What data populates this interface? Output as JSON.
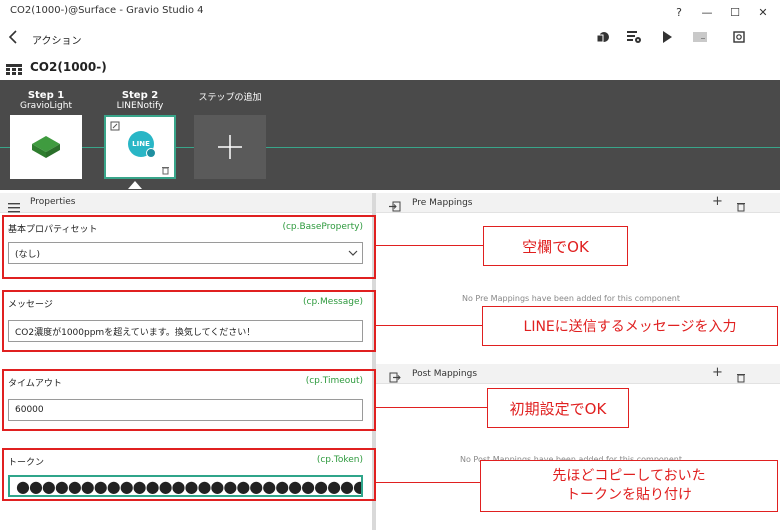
{
  "window": {
    "title": "CO2(1000-)@Surface - Gravio Studio 4",
    "controls": {
      "help": "?",
      "minimize": "—",
      "maximize": "☐",
      "close": "✕"
    }
  },
  "header": {
    "title": "アクション"
  },
  "toolbar": {
    "icons": [
      "save-icon",
      "settings-list-icon",
      "play-icon",
      "console-icon",
      "refresh-icon"
    ]
  },
  "action": {
    "name": "CO2(1000-)"
  },
  "steps": [
    {
      "title": "Step 1",
      "component": "GravioLight"
    },
    {
      "title": "Step 2",
      "component": "LINENotify",
      "badge": "LINE"
    },
    {
      "title": "ステップの追加",
      "component": ""
    }
  ],
  "properties": {
    "header": "Properties",
    "items": [
      {
        "label": "基本プロパティセット",
        "binding": "(cp.BaseProperty)",
        "value": "(なし)",
        "type": "select"
      },
      {
        "label": "メッセージ",
        "binding": "(cp.Message)",
        "value": "CO2濃度が1000ppmを超えています。換気してください！",
        "type": "text"
      },
      {
        "label": "タイムアウト",
        "binding": "(cp.Timeout)",
        "value": "60000",
        "type": "text"
      },
      {
        "label": "トークン",
        "binding": "(cp.Token)",
        "value": "●●●●●●●●●●●●●●●●●●●●●●●●●●●●●●●●●●●●●●●●●●●",
        "type": "password"
      }
    ]
  },
  "pre_mappings": {
    "title": "Pre Mappings",
    "empty": "No Pre Mappings have been added for this component"
  },
  "post_mappings": {
    "title": "Post Mappings",
    "empty": "No Post Mappings have been added for this component"
  },
  "annotations": {
    "callout1": "空欄でOK",
    "callout2": "LINEに送信するメッセージを入力",
    "callout3": "初期設定でOK",
    "callout4_line1": "先ほどコピーしておいた",
    "callout4_line2": "トークンを貼り付け"
  },
  "colors": {
    "accent": "#39a58a",
    "binding_green": "#2e9a3e",
    "annotation_red": "#e02020",
    "strip_bg": "#4a4a4a"
  }
}
